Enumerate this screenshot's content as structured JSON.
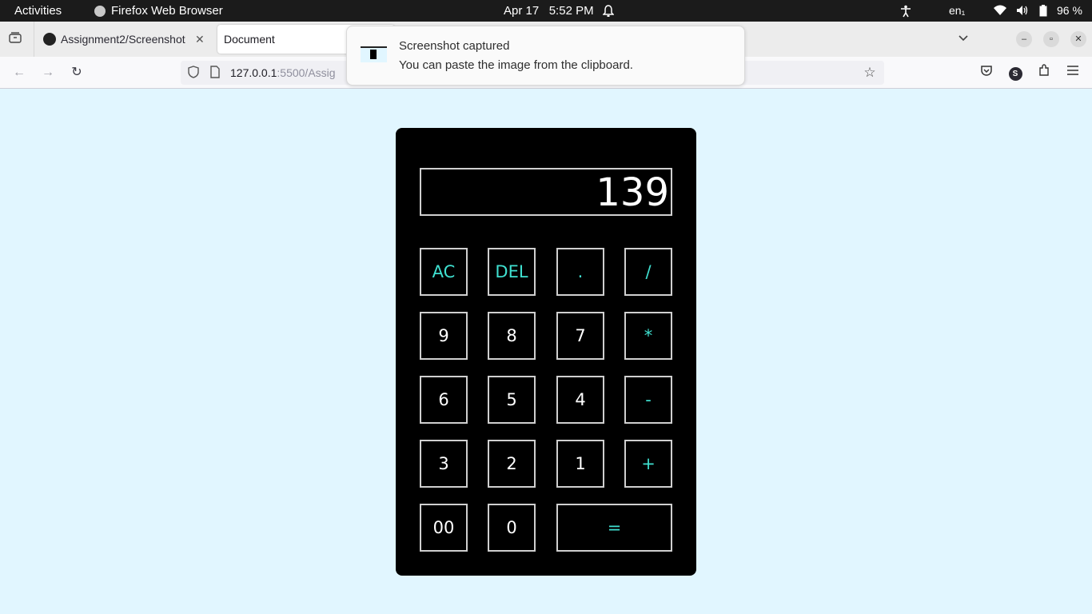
{
  "system_bar": {
    "activities": "Activities",
    "app_name": "Firefox Web Browser",
    "date": "Apr 17",
    "time": "5:52 PM",
    "keyboard_layout": "en₁",
    "battery": "96 %"
  },
  "browser": {
    "tabs": [
      {
        "title": "Assignment2/Screenshot",
        "active": false
      },
      {
        "title": "Document",
        "active": true
      }
    ],
    "url_host": "127.0.0.1",
    "url_rest": ":5500/Assig"
  },
  "notification": {
    "title": "Screenshot captured",
    "body": "You can paste the image from the clipboard."
  },
  "calculator": {
    "display": "139",
    "colors": {
      "operator": "#3fe0d0",
      "digit": "#ffffff",
      "background": "#000000",
      "page": "#e1f6ff"
    },
    "keys": [
      "AC",
      "DEL",
      ".",
      "/",
      "9",
      "8",
      "7",
      "*",
      "6",
      "5",
      "4",
      "-",
      "3",
      "2",
      "1",
      "+",
      "00",
      "0",
      "="
    ]
  }
}
